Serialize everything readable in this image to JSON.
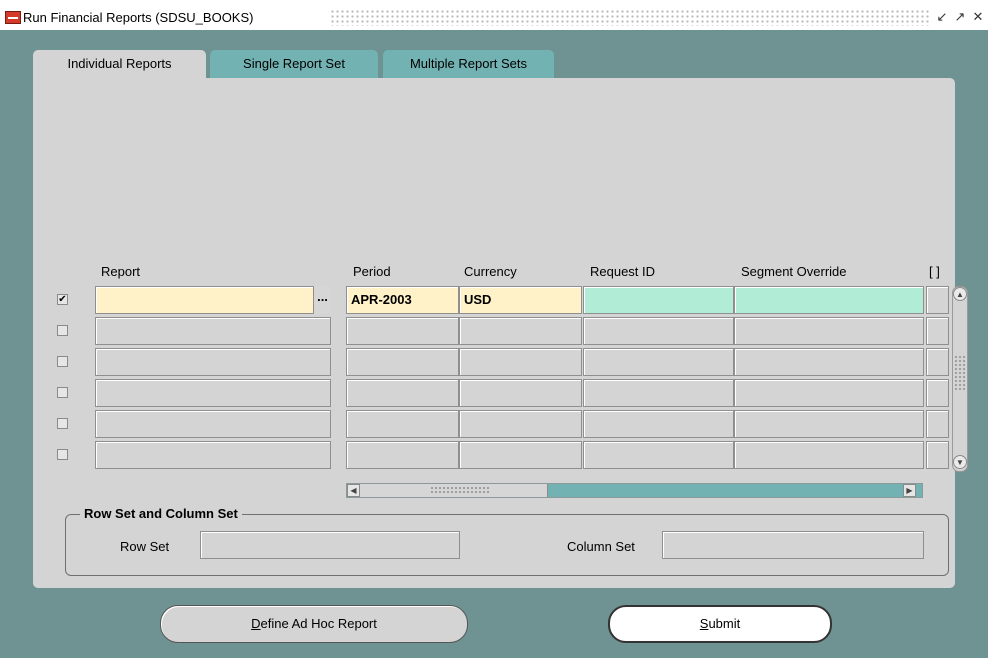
{
  "window": {
    "title": "Run Financial Reports (SDSU_BOOKS)",
    "controls": [
      "minimize-icon",
      "maximize-icon",
      "close-icon"
    ]
  },
  "tabs": [
    {
      "label": "Individual Reports",
      "active": true
    },
    {
      "label": "Single Report Set",
      "active": false
    },
    {
      "label": "Multiple Report Sets",
      "active": false
    }
  ],
  "grid": {
    "headers": {
      "report": "Report",
      "period": "Period",
      "currency": "Currency",
      "request_id": "Request ID",
      "segment_override": "Segment Override",
      "extra": "[ ]"
    },
    "rows": [
      {
        "checked": true,
        "report": "",
        "period": "APR-2003",
        "currency": "USD",
        "request_id": "",
        "segment_override": ""
      },
      {
        "checked": false,
        "report": "",
        "period": "",
        "currency": "",
        "request_id": "",
        "segment_override": ""
      },
      {
        "checked": false,
        "report": "",
        "period": "",
        "currency": "",
        "request_id": "",
        "segment_override": ""
      },
      {
        "checked": false,
        "report": "",
        "period": "",
        "currency": "",
        "request_id": "",
        "segment_override": ""
      },
      {
        "checked": false,
        "report": "",
        "period": "",
        "currency": "",
        "request_id": "",
        "segment_override": ""
      },
      {
        "checked": false,
        "report": "",
        "period": "",
        "currency": "",
        "request_id": "",
        "segment_override": ""
      }
    ],
    "lov_label": "..."
  },
  "rowcol": {
    "legend": "Row Set and Column Set",
    "row_set_label": "Row Set",
    "row_set_value": "",
    "column_set_label": "Column Set",
    "column_set_value": ""
  },
  "buttons": {
    "adhoc": {
      "mnemonic": "D",
      "rest": "efine Ad Hoc Report"
    },
    "submit": {
      "mnemonic": "S",
      "rest": "ubmit"
    }
  },
  "colors": {
    "window_bg": "#6f9393",
    "panel_bg": "#d4d4d4",
    "inactive_tab": "#73b2b2",
    "required_field": "#fff2c9",
    "readonly_field": "#b0ecd6"
  }
}
